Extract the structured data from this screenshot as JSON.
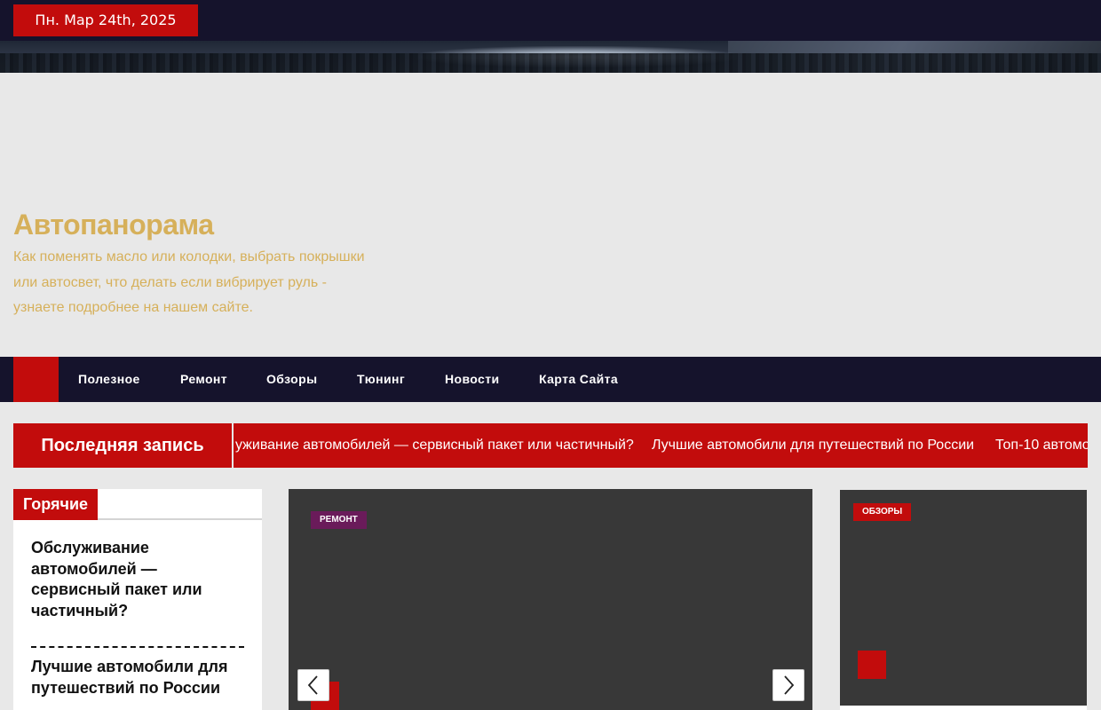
{
  "topbar": {
    "date": "Пн. Мар 24th, 2025"
  },
  "site": {
    "title": "Автопанорама",
    "description": "Как поменять масло или колодки, выбрать покрышки или автосвет, что делать если вибрирует руль - узнаете подробнее на нашем сайте."
  },
  "nav": {
    "items": [
      {
        "label": "Полезное"
      },
      {
        "label": "Ремонт"
      },
      {
        "label": "Обзоры"
      },
      {
        "label": "Тюнинг"
      },
      {
        "label": "Новости"
      },
      {
        "label": "Карта Сайта"
      }
    ]
  },
  "ticker": {
    "label": "Последняя запись",
    "items": [
      "уживание автомобилей — сервисный пакет или частичный?",
      "Лучшие автомобили для путешествий по России",
      "Топ-10 автомо"
    ]
  },
  "hot": {
    "label": "Горячие",
    "posts": [
      "Обслуживание автомобилей — сервисный пакет или частичный?",
      "Лучшие автомобили для путешествий по России"
    ]
  },
  "slider": {
    "category": "Ремонт"
  },
  "side_card": {
    "category": "Обзоры"
  },
  "colors": {
    "accent": "#c20c0c",
    "dark": "#15132c",
    "gold": "#d6b05a",
    "purple": "#6a1b5a"
  }
}
